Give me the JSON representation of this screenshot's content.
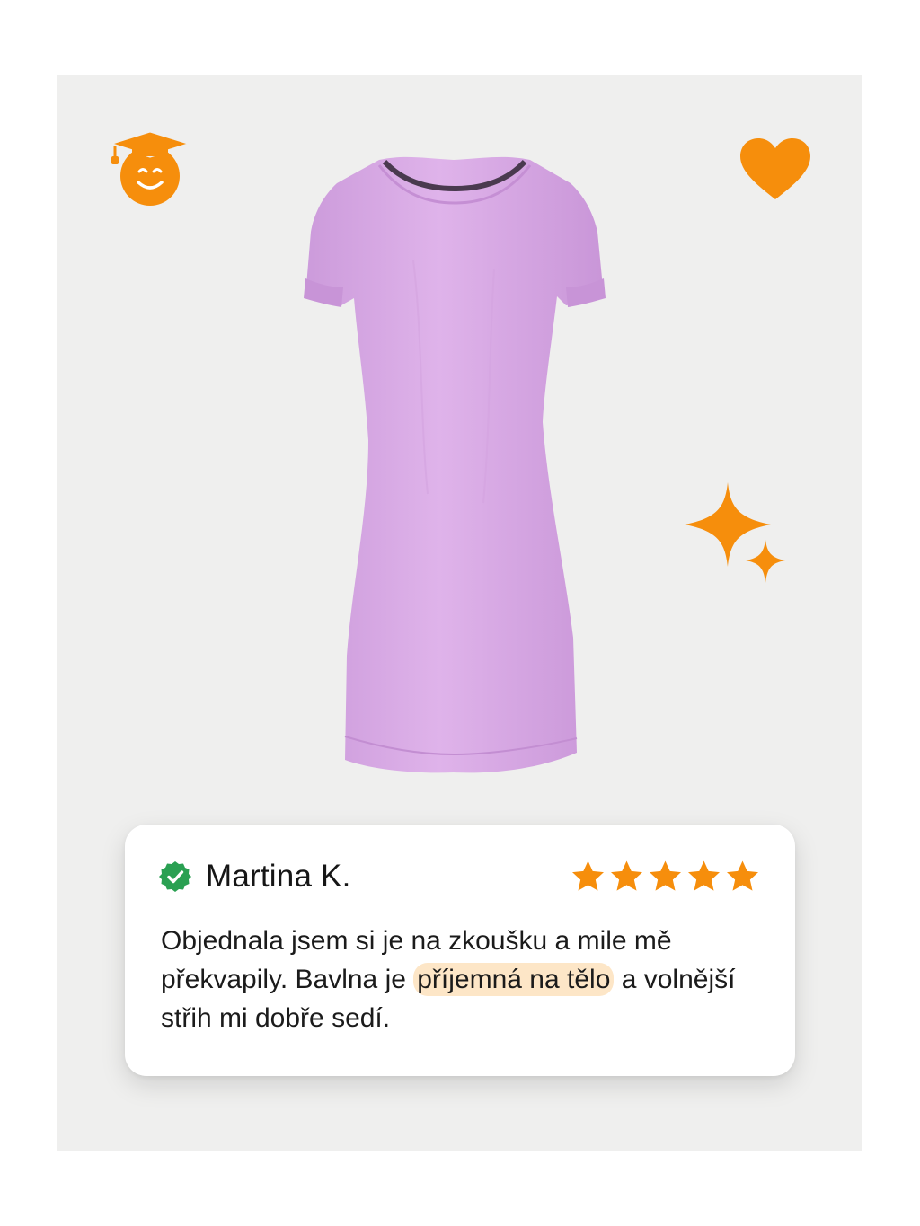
{
  "icons": {
    "graduate": "graduation-cap-smiley-icon",
    "heart": "heart-icon",
    "sparkle": "sparkles-icon",
    "verified": "verified-check-icon",
    "star": "star-icon"
  },
  "colors": {
    "accent": "#f68e0c",
    "verified": "#2aa052",
    "dress": "#d9abe6",
    "highlight": "#fde6c7",
    "background": "#efefee"
  },
  "review": {
    "name": "Martina K.",
    "rating": 5,
    "text_before": "Objednala jsem si je na zkoušku a mile mě překvapily. Bavlna je ",
    "highlight": "příjemná na tělo",
    "text_after": " a volnější střih mi dobře sedí."
  }
}
